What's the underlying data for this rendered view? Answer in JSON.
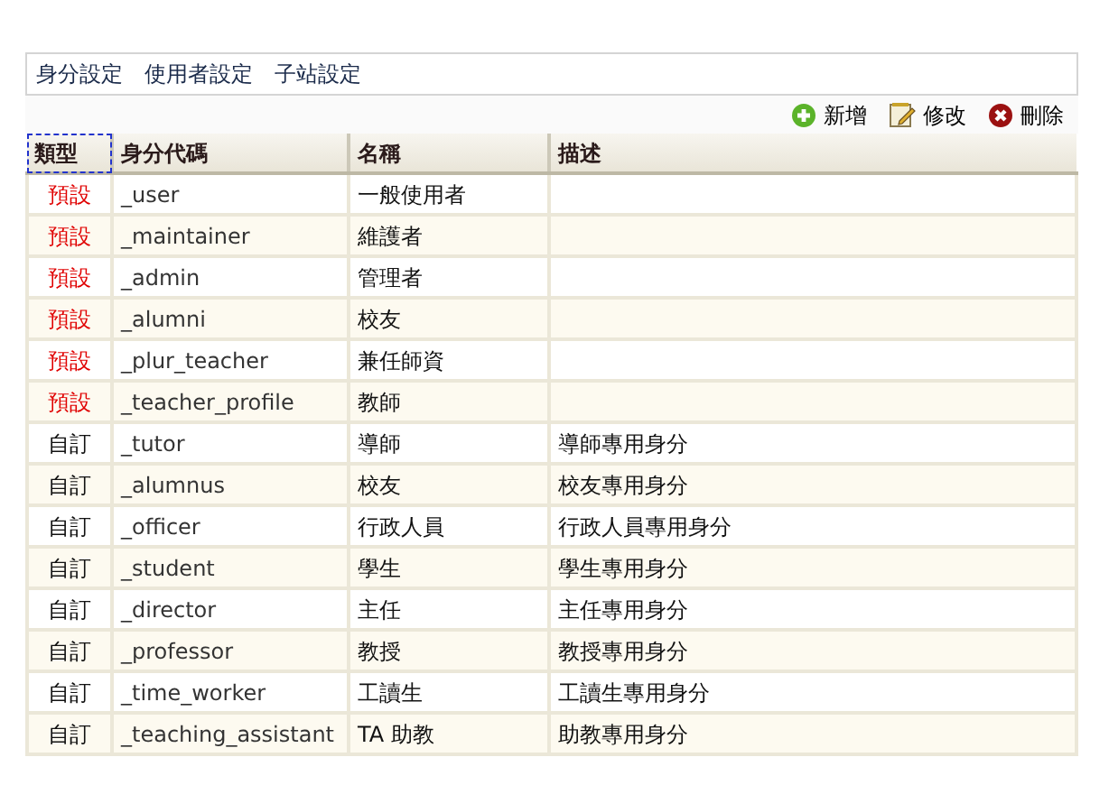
{
  "nav": [
    {
      "label": "身分設定"
    },
    {
      "label": "使用者設定"
    },
    {
      "label": "子站設定"
    }
  ],
  "toolbar": [
    {
      "kind": "add",
      "label": "新增"
    },
    {
      "kind": "edit",
      "label": "修改"
    },
    {
      "kind": "delete",
      "label": "刪除"
    }
  ],
  "table": {
    "columns": [
      {
        "label": "類型",
        "focused": true
      },
      {
        "label": "身分代碼",
        "focused": false
      },
      {
        "label": "名稱",
        "focused": false
      },
      {
        "label": "描述",
        "focused": false
      }
    ],
    "rows": [
      {
        "kind": "default",
        "type": "預設",
        "code": "_user",
        "name": "一般使用者"
      },
      {
        "kind": "default",
        "type": "預設",
        "code": "_maintainer",
        "name": "維護者"
      },
      {
        "kind": "default",
        "type": "預設",
        "code": "_admin",
        "name": "管理者"
      },
      {
        "kind": "default",
        "type": "預設",
        "code": "_alumni",
        "name": "校友"
      },
      {
        "kind": "default",
        "type": "預設",
        "code": "_plur_teacher",
        "name": "兼任師資"
      },
      {
        "kind": "default",
        "type": "預設",
        "code": "_teacher_profile",
        "name": "教師"
      },
      {
        "kind": "custom",
        "type": "自訂",
        "code": "_tutor",
        "name": "導師",
        "description": "導師專用身分"
      },
      {
        "kind": "custom",
        "type": "自訂",
        "code": "_alumnus",
        "name": "校友",
        "description": "校友專用身分"
      },
      {
        "kind": "custom",
        "type": "自訂",
        "code": "_officer",
        "name": "行政人員",
        "description": "行政人員專用身分"
      },
      {
        "kind": "custom",
        "type": "自訂",
        "code": "_student",
        "name": "學生",
        "description": "學生專用身分"
      },
      {
        "kind": "custom",
        "type": "自訂",
        "code": "_director",
        "name": "主任",
        "description": "主任專用身分"
      },
      {
        "kind": "custom",
        "type": "自訂",
        "code": "_professor",
        "name": "教授",
        "description": "教授專用身分"
      },
      {
        "kind": "custom",
        "type": "自訂",
        "code": "_time_worker",
        "name": "工讀生",
        "description": "工讀生專用身分"
      },
      {
        "kind": "custom",
        "type": "自訂",
        "code": "_teaching_assistant",
        "name": "TA 助教",
        "description": "助教專用身分"
      }
    ]
  }
}
